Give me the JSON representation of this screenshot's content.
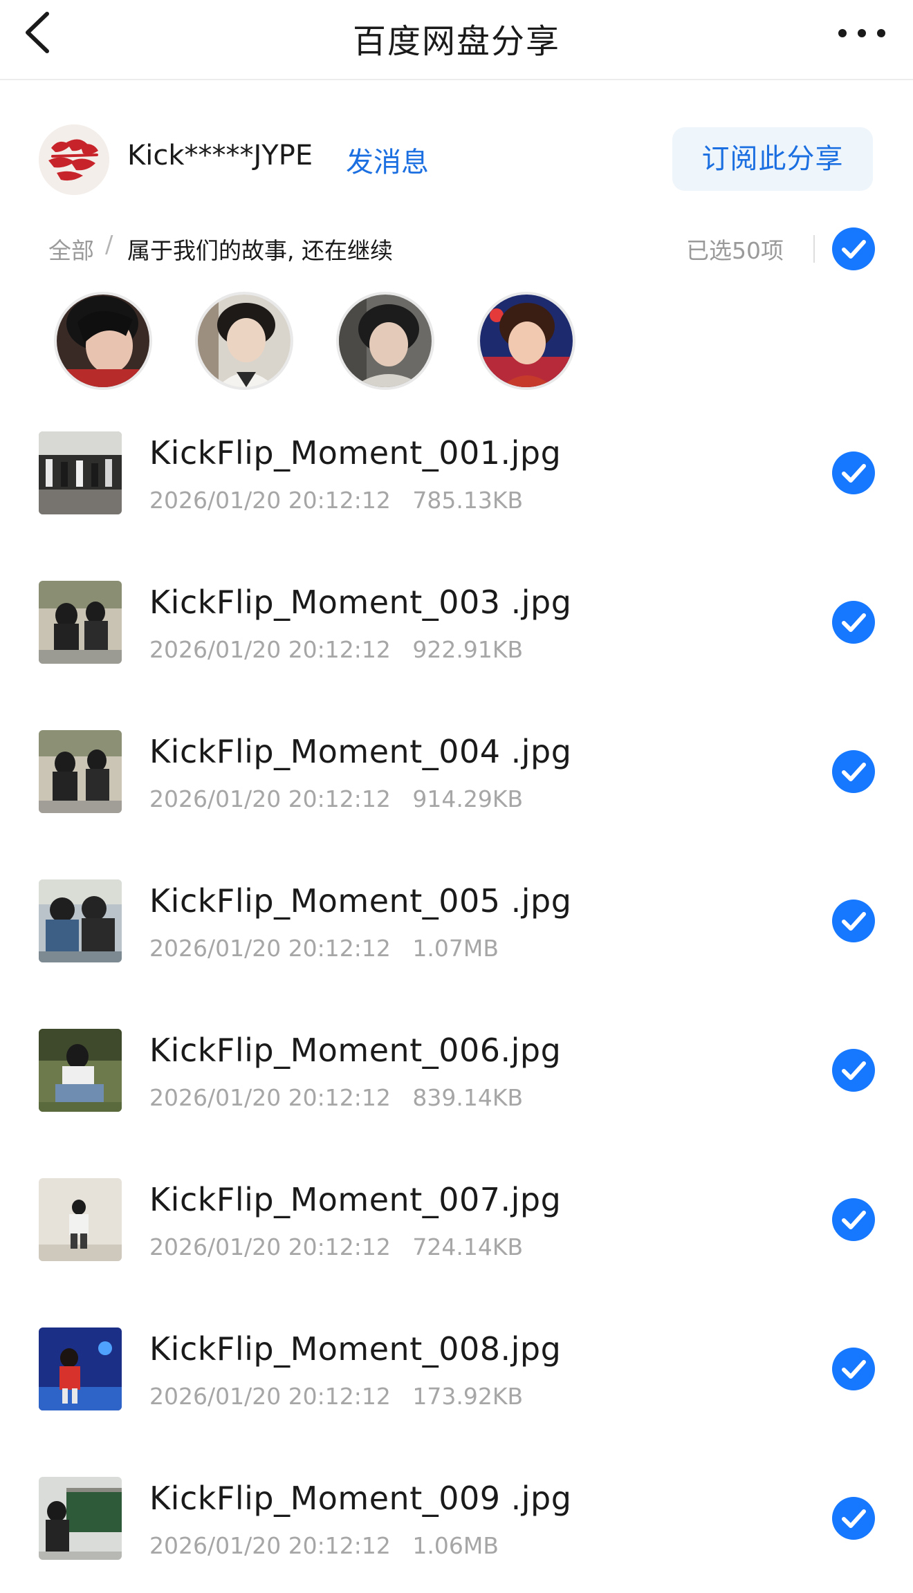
{
  "nav": {
    "title": "百度网盘分享",
    "back_icon": "chevron-left-icon",
    "more_icon": "more-horizontal-icon"
  },
  "owner": {
    "name": "Kick*****JYPE",
    "message_label": "发消息",
    "subscribe_label": "订阅此分享"
  },
  "breadcrumb": {
    "root": "全部",
    "separator": "/",
    "current": "属于我们的故事, 还在继续"
  },
  "selection": {
    "count_label": "已选50项",
    "all_selected": true
  },
  "faces": [
    "face-1",
    "face-2",
    "face-3",
    "face-4"
  ],
  "files": [
    {
      "name": "KickFlip_Moment_001.jpg",
      "date": "2026/01/20 20:12:12",
      "size": "785.13KB",
      "checked": true
    },
    {
      "name": "KickFlip_Moment_003 .jpg",
      "date": "2026/01/20 20:12:12",
      "size": "922.91KB",
      "checked": true
    },
    {
      "name": "KickFlip_Moment_004 .jpg",
      "date": "2026/01/20 20:12:12",
      "size": "914.29KB",
      "checked": true
    },
    {
      "name": "KickFlip_Moment_005 .jpg",
      "date": "2026/01/20 20:12:12",
      "size": "1.07MB",
      "checked": true
    },
    {
      "name": "KickFlip_Moment_006.jpg",
      "date": "2026/01/20 20:12:12",
      "size": "839.14KB",
      "checked": true
    },
    {
      "name": "KickFlip_Moment_007.jpg",
      "date": "2026/01/20 20:12:12",
      "size": "724.14KB",
      "checked": true
    },
    {
      "name": "KickFlip_Moment_008.jpg",
      "date": "2026/01/20 20:12:12",
      "size": "173.92KB",
      "checked": true
    },
    {
      "name": "KickFlip_Moment_009 .jpg",
      "date": "2026/01/20 20:12:12",
      "size": "1.06MB",
      "checked": true
    }
  ],
  "colors": {
    "accent": "#1b6fe0",
    "check": "#1677ff",
    "muted": "#a6a6a6",
    "subscribe_bg": "#eef5fb"
  }
}
